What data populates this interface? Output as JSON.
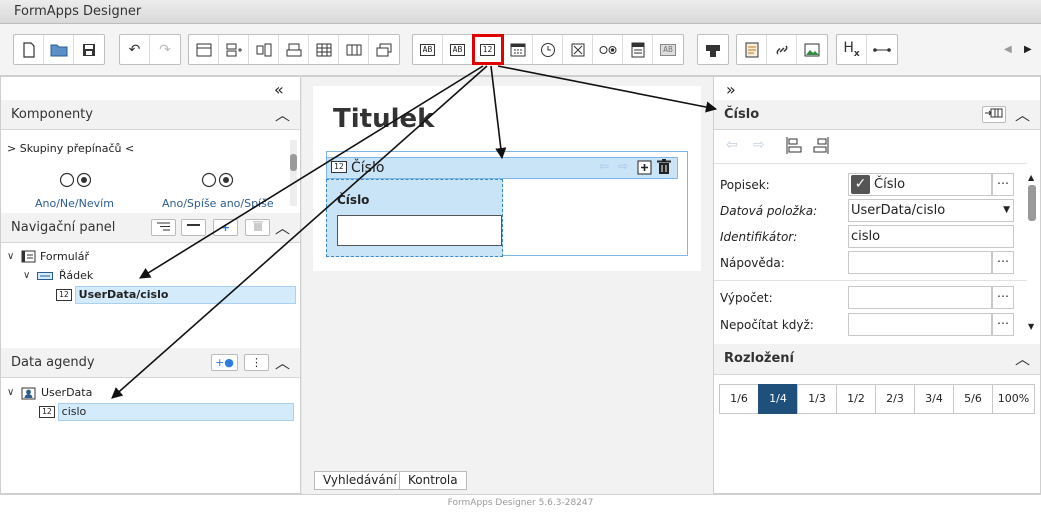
{
  "app": {
    "title": "FormApps Designer",
    "version": "FormApps Designer 5.6.3-28247"
  },
  "icons": {
    "number_field": "12",
    "textbox_label": "AB",
    "textbox_multi_label": "AB",
    "collapse_left": "«",
    "expand_right": "»",
    "chevron_up": "︿",
    "subscript_h": "H",
    "subscript_x": "x"
  },
  "left": {
    "components": {
      "title": "Komponenty",
      "group_label": "> Skupiny přepínačů <",
      "options": [
        {
          "label": "Ano/Ne/Nevím"
        },
        {
          "label": "Ano/Spíše ano/Spíše"
        }
      ]
    },
    "nav": {
      "title": "Navigační panel",
      "tree": {
        "root": "Formulář",
        "row": "Řádek",
        "field": "UserData/cislo"
      }
    },
    "data": {
      "title": "Data agendy",
      "tree": {
        "root": "UserData",
        "field": "cislo"
      }
    }
  },
  "canvas": {
    "heading": "Titulek",
    "row_label": "Číslo",
    "field_label": "Číslo",
    "tabs": {
      "search": "Vyhledávání",
      "check": "Kontrola"
    }
  },
  "properties": {
    "title": "Číslo",
    "caption_label": "Popisek:",
    "caption_value": "Číslo",
    "data_item_label": "Datová položka:",
    "data_item_value": "UserData/cislo",
    "identifier_label": "Identifikátor:",
    "identifier_value": "cislo",
    "help_label": "Nápověda:",
    "calculation_label": "Výpočet:",
    "no_calc_label": "Nepočítat když:",
    "dots": "⋯"
  },
  "layout": {
    "title": "Rozložení",
    "options": [
      "1/6",
      "1/4",
      "1/3",
      "1/2",
      "2/3",
      "3/4",
      "5/6",
      "100%"
    ],
    "selected": "1/4"
  },
  "colors": {
    "accent": "#1f4f7b",
    "highlight": "#d4ebfb",
    "selection": "#e00000"
  }
}
